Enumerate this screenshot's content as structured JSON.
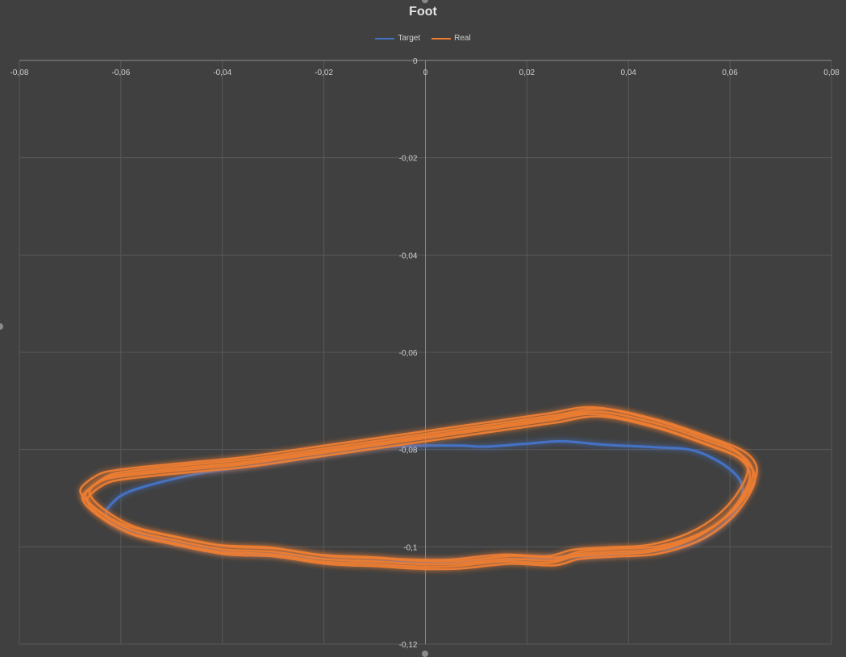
{
  "chart_data": {
    "type": "scatter",
    "title": "Foot",
    "legend_position": "top",
    "grid": true,
    "xlim": [
      -0.08,
      0.08
    ],
    "ylim": [
      -0.12,
      0
    ],
    "x_ticks": [
      {
        "value": -0.08,
        "label": "-0,08"
      },
      {
        "value": -0.06,
        "label": "-0,06"
      },
      {
        "value": -0.04,
        "label": "-0,04"
      },
      {
        "value": -0.02,
        "label": "-0,02"
      },
      {
        "value": 0,
        "label": "0"
      },
      {
        "value": 0.02,
        "label": "0,02"
      },
      {
        "value": 0.04,
        "label": "0,04"
      },
      {
        "value": 0.06,
        "label": "0,06"
      },
      {
        "value": 0.08,
        "label": "0,08"
      }
    ],
    "y_ticks": [
      {
        "value": 0,
        "label": "0"
      },
      {
        "value": -0.02,
        "label": "-0,02"
      },
      {
        "value": -0.04,
        "label": "-0,04"
      },
      {
        "value": -0.06,
        "label": "-0,06"
      },
      {
        "value": -0.08,
        "label": "-0,08"
      },
      {
        "value": -0.1,
        "label": "-0,1"
      },
      {
        "value": -0.12,
        "label": "-0,12"
      }
    ],
    "series": [
      {
        "name": "Target",
        "color": "#4472c4",
        "points": [
          [
            -0.063,
            -0.0925
          ],
          [
            -0.06,
            -0.0895
          ],
          [
            -0.055,
            -0.0875
          ],
          [
            -0.045,
            -0.085
          ],
          [
            -0.035,
            -0.0835
          ],
          [
            -0.025,
            -0.082
          ],
          [
            -0.015,
            -0.0805
          ],
          [
            -0.008,
            -0.0795
          ],
          [
            0.0,
            -0.0792
          ],
          [
            0.007,
            -0.0792
          ],
          [
            0.012,
            -0.0794
          ],
          [
            0.02,
            -0.0788
          ],
          [
            0.027,
            -0.0783
          ],
          [
            0.035,
            -0.079
          ],
          [
            0.045,
            -0.0795
          ],
          [
            0.052,
            -0.08
          ],
          [
            0.057,
            -0.082
          ],
          [
            0.061,
            -0.085
          ],
          [
            0.0625,
            -0.088
          ],
          [
            0.0615,
            -0.092
          ],
          [
            0.058,
            -0.096
          ],
          [
            0.052,
            -0.0995
          ],
          [
            0.043,
            -0.101
          ],
          [
            0.03,
            -0.102
          ],
          [
            0.02,
            -0.1025
          ],
          [
            0.01,
            -0.103
          ],
          [
            0.0,
            -0.1032
          ],
          [
            -0.01,
            -0.103
          ],
          [
            -0.02,
            -0.1025
          ],
          [
            -0.03,
            -0.1015
          ],
          [
            -0.04,
            -0.101
          ],
          [
            -0.05,
            -0.099
          ],
          [
            -0.057,
            -0.097
          ],
          [
            -0.062,
            -0.095
          ],
          [
            -0.063,
            -0.0925
          ]
        ]
      },
      {
        "name": "Real",
        "color": "#ed7d31",
        "points": [
          [
            -0.065,
            -0.087
          ],
          [
            -0.062,
            -0.0855
          ],
          [
            -0.055,
            -0.0845
          ],
          [
            -0.045,
            -0.0835
          ],
          [
            -0.035,
            -0.0825
          ],
          [
            -0.025,
            -0.081
          ],
          [
            -0.015,
            -0.0795
          ],
          [
            -0.005,
            -0.078
          ],
          [
            0.005,
            -0.0765
          ],
          [
            0.015,
            -0.075
          ],
          [
            0.025,
            -0.0735
          ],
          [
            0.034,
            -0.0722
          ],
          [
            0.045,
            -0.0745
          ],
          [
            0.055,
            -0.078
          ],
          [
            0.062,
            -0.081
          ],
          [
            0.0645,
            -0.0845
          ],
          [
            0.063,
            -0.089
          ],
          [
            0.059,
            -0.094
          ],
          [
            0.053,
            -0.098
          ],
          [
            0.045,
            -0.1005
          ],
          [
            0.037,
            -0.101
          ],
          [
            0.03,
            -0.1015
          ],
          [
            0.025,
            -0.1028
          ],
          [
            0.016,
            -0.1025
          ],
          [
            0.006,
            -0.1035
          ],
          [
            -0.002,
            -0.1035
          ],
          [
            -0.01,
            -0.103
          ],
          [
            -0.02,
            -0.1025
          ],
          [
            -0.03,
            -0.101
          ],
          [
            -0.04,
            -0.1005
          ],
          [
            -0.05,
            -0.0985
          ],
          [
            -0.058,
            -0.0965
          ],
          [
            -0.064,
            -0.093
          ],
          [
            -0.067,
            -0.0895
          ],
          [
            -0.065,
            -0.087
          ]
        ],
        "loops": [
          {
            "dx": 0.0,
            "dy": 0.0
          },
          {
            "dx": 0.0008,
            "dy": 0.0006
          },
          {
            "dx": -0.0006,
            "dy": -0.0005
          },
          {
            "dx": 0.0004,
            "dy": -0.001
          },
          {
            "dx": -0.001,
            "dy": 0.0009
          }
        ]
      }
    ]
  }
}
